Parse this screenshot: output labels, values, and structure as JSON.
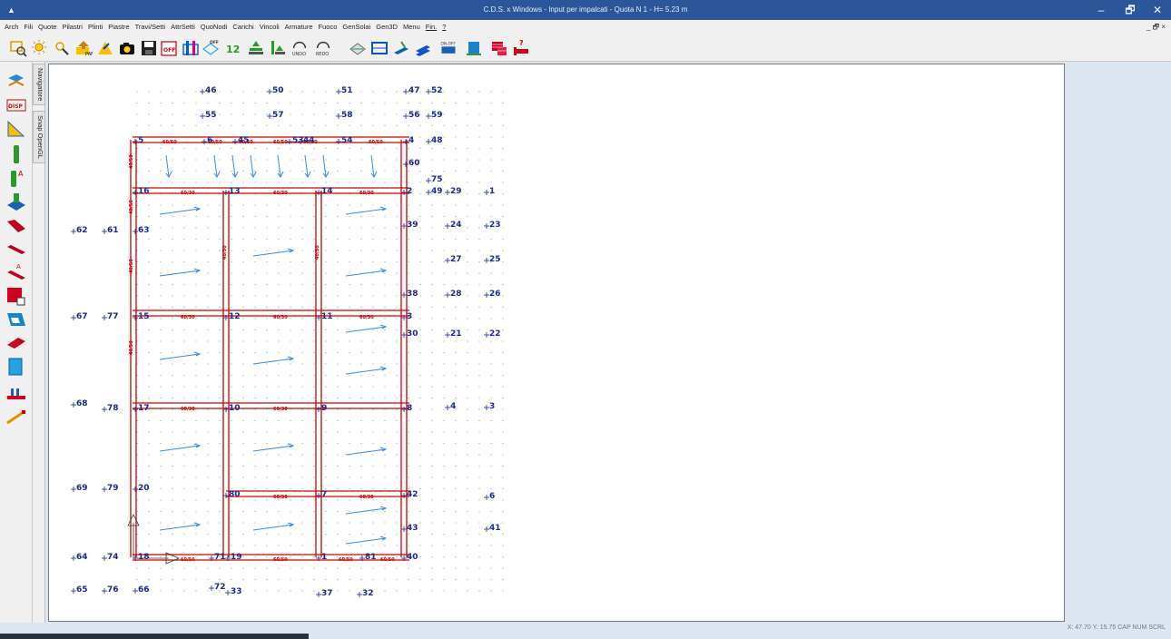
{
  "window": {
    "title": "C.D.S. x Windows - Input per impalcati - Quota N 1 - H= 5.23 m",
    "min_label": "–",
    "max_label": "🗗",
    "close_label": "✕",
    "mdi_controls": "_ 🗗 ×"
  },
  "menu": {
    "items": [
      "Arch",
      "Fili",
      "Quote",
      "Pilastri",
      "Plinti",
      "Piastre",
      "Travi/Setti",
      "AttrSetti",
      "QuoNodi",
      "Carichi",
      "Vincoli",
      "Armature",
      "Fuoco",
      "GenSolai",
      "Gen3D",
      "Menu",
      "Fin.",
      "?"
    ]
  },
  "toolbar": {
    "icons": [
      "zoom-window-icon",
      "zoom-all-icon",
      "zoom-out-icon",
      "pan-icon",
      "redraw-icon",
      "camera-icon",
      "save-icon",
      "off-icon",
      "columns-icon",
      "diamond-off-icon",
      "numbering-icon",
      "foundation-icon",
      "piers-icon",
      "undo-icon",
      "redo-icon",
      "beams-3d-icon",
      "slab-icon",
      "load-icon",
      "layer-icon",
      "onoff-icon",
      "building-icon",
      "bricks-icon",
      "help-bed-icon"
    ],
    "undo_label": "UNDO",
    "redo_label": "REDO",
    "onoff_label": "ON-OFF",
    "off_label": "OFF"
  },
  "left_tools": [
    "navigate-icon",
    "disp-icon",
    "triangle-icon",
    "column-icon",
    "column-a-icon",
    "foundation-block-icon",
    "sofa-icon",
    "beam-icon",
    "beam-a-icon",
    "red-square-icon",
    "wall-icon",
    "slab-plate-icon",
    "cyan-rect-icon",
    "stairs-icon",
    "ramp-icon"
  ],
  "side_tabs": [
    "Navigatore",
    "Snap OpenGL"
  ],
  "status": {
    "coords": "X: 47.70  Y: 15.75  CAP  NUM  SCRL"
  },
  "drawing": {
    "node_labels": [
      "46",
      "50",
      "51",
      "47",
      "52",
      "55",
      "57",
      "58",
      "56",
      "59",
      "5",
      "6",
      "45",
      "53",
      "44",
      "54",
      "4",
      "48",
      "60",
      "75",
      "49",
      "29",
      "1",
      "16",
      "13",
      "14",
      "2",
      "62",
      "61",
      "63",
      "39",
      "24",
      "23",
      "27",
      "25",
      "38",
      "28",
      "26",
      "67",
      "77",
      "15",
      "12",
      "11",
      "3",
      "30",
      "21",
      "22",
      "68",
      "78",
      "17",
      "10",
      "9",
      "8",
      "4",
      "3",
      "69",
      "79",
      "20",
      "80",
      "7",
      "42",
      "6",
      "43",
      "41",
      "64",
      "74",
      "18",
      "71",
      "19",
      "1",
      "81",
      "40",
      "65",
      "76",
      "66",
      "72",
      "33",
      "37",
      "32"
    ],
    "beam_labels": [
      "60/50",
      "60/50",
      "60/50",
      "60/50",
      "60/50",
      "60/50",
      "40/50",
      "60/30",
      "60/30",
      "60/30",
      "40/50",
      "40/50",
      "40/50",
      "40/50",
      "60/30",
      "60/30",
      "60/30",
      "60/30",
      "60/30",
      "40/50",
      "60/30",
      "60/30",
      "60/50",
      "60/50",
      "60/50",
      "60/50"
    ]
  }
}
